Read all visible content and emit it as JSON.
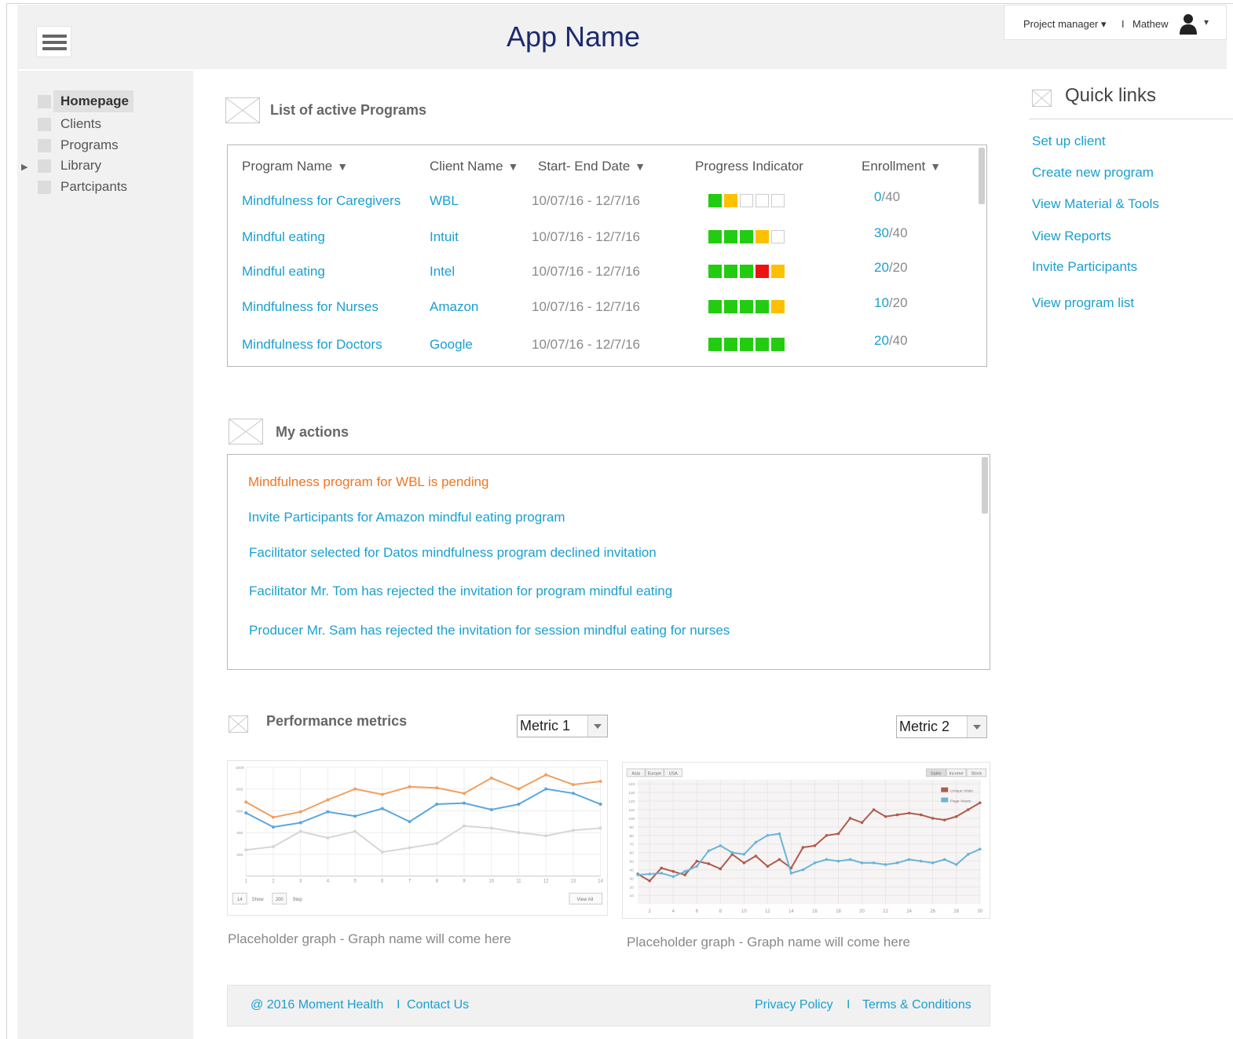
{
  "header": {
    "app_name": "App Name",
    "role": "Project manager ▾",
    "separator": "I",
    "user_name": "Mathew",
    "user_caret": "▾"
  },
  "sidebar": {
    "items": [
      {
        "label": "Homepage",
        "active": true
      },
      {
        "label": "Clients"
      },
      {
        "label": "Programs"
      },
      {
        "label": "Library",
        "expandable": true
      },
      {
        "label": "Partcipants"
      }
    ]
  },
  "programs": {
    "title": "List of active Programs",
    "columns": [
      "Program Name",
      "Client Name",
      "Start- End Date",
      "Progress Indicator",
      "Enrollment"
    ],
    "rows": [
      {
        "program": "Mindfulness for Caregivers",
        "client": "WBL",
        "dates": "10/07/16 - 12/7/16",
        "progress": [
          "green",
          "yellow",
          "empty",
          "empty",
          "empty"
        ],
        "enrolled": "0",
        "capacity": "/40"
      },
      {
        "program": "Mindful eating",
        "client": "Intuit",
        "dates": "10/07/16 - 12/7/16",
        "progress": [
          "green",
          "green",
          "green",
          "yellow",
          "empty"
        ],
        "enrolled": "30",
        "capacity": "/40"
      },
      {
        "program": "Mindful eating",
        "client": "Intel",
        "dates": "10/07/16 - 12/7/16",
        "progress": [
          "green",
          "green",
          "green",
          "red",
          "yellow"
        ],
        "enrolled": "20",
        "capacity": "/20"
      },
      {
        "program": "Mindfulness for Nurses",
        "client": "Amazon",
        "dates": "10/07/16 - 12/7/16",
        "progress": [
          "green",
          "green",
          "green",
          "green",
          "yellow"
        ],
        "enrolled": "10",
        "capacity": "/20"
      },
      {
        "program": "Mindfulness for Doctors",
        "client": "Google",
        "dates": "10/07/16 - 12/7/16",
        "progress": [
          "green",
          "green",
          "green",
          "green",
          "green"
        ],
        "enrolled": "20",
        "capacity": "/40"
      }
    ]
  },
  "actions": {
    "title": "My actions",
    "items": [
      {
        "text": "Mindfulness program for WBL is pending",
        "status": "pending"
      },
      {
        "text": "Invite Participants for Amazon mindful eating program"
      },
      {
        "text": "Facilitator selected for Datos mindfulness program declined invitation"
      },
      {
        "text": "Facilitator Mr. Tom  has rejected the invitation for program mindful eating"
      },
      {
        "text": "Producer Mr. Sam  has rejected the invitation for session mindful eating  for nurses"
      }
    ]
  },
  "metrics": {
    "title": "Performance metrics",
    "metric1": "Metric 1",
    "metric2": "Metric 2",
    "caption1": "Placeholder graph - Graph name will come here",
    "caption2": "Placeholder graph - Graph name will come here"
  },
  "quick_links": {
    "title": "Quick links",
    "links": [
      "Set up client",
      "Create new program",
      "View Material & Tools",
      "View Reports",
      "Invite Participants",
      "View program list"
    ]
  },
  "footer": {
    "copyright": "@ 2016 Moment Health",
    "sep": "I",
    "contact": "Contact Us",
    "privacy": "Privacy Policy",
    "sep2": "I",
    "terms": "Terms & Conditions"
  },
  "colors": {
    "link": "#1a9fd0",
    "pending": "#f07522",
    "progress_green": "#22cc11",
    "progress_yellow": "#ffc000",
    "progress_red": "#ee1111",
    "app_name": "#1c2a6e"
  },
  "chart_data": [
    {
      "type": "line",
      "x": [
        1,
        2,
        3,
        4,
        5,
        6,
        7,
        8,
        9,
        10,
        11,
        12,
        13,
        14
      ],
      "ylim": [
        0,
        1000
      ],
      "y_ticks": [
        "1000",
        "800",
        "600",
        "400",
        "200"
      ],
      "controls": [
        "14",
        "Show",
        "200",
        "Step",
        "View All"
      ],
      "series": [
        {
          "color": "#f0a060",
          "values": [
            680,
            540,
            590,
            700,
            800,
            750,
            820,
            810,
            760,
            900,
            800,
            930,
            840,
            870
          ]
        },
        {
          "color": "#5aa6dc",
          "values": [
            580,
            450,
            490,
            590,
            550,
            620,
            500,
            660,
            670,
            610,
            660,
            800,
            760,
            660
          ]
        },
        {
          "color": "#d6d6d6",
          "values": [
            240,
            270,
            410,
            350,
            410,
            220,
            260,
            300,
            460,
            440,
            400,
            370,
            420,
            440
          ]
        }
      ]
    },
    {
      "type": "line",
      "x": [
        1,
        2,
        3,
        4,
        5,
        6,
        7,
        8,
        9,
        10,
        11,
        12,
        13,
        14,
        15,
        16,
        17,
        18,
        19,
        20,
        21,
        22,
        23,
        24,
        25,
        26,
        27,
        28,
        29,
        30
      ],
      "x_ticks": [
        "2",
        "4",
        "6",
        "8",
        "10",
        "12",
        "14",
        "16",
        "18",
        "20",
        "22",
        "24",
        "26",
        "28",
        "30"
      ],
      "y_ticks": [
        "140",
        "130",
        "120",
        "110",
        "100",
        "90",
        "80",
        "70",
        "60",
        "50",
        "40",
        "30",
        "20",
        "10"
      ],
      "ylim": [
        0,
        145
      ],
      "tabs_left": [
        "Asia",
        "Europe",
        "USA"
      ],
      "tabs_right": [
        "Sales",
        "Income",
        "Stock"
      ],
      "series": [
        {
          "name": "Unique Visits",
          "color": "#b05a4a",
          "values": [
            35,
            27,
            42,
            38,
            34,
            50,
            47,
            41,
            58,
            48,
            56,
            44,
            52,
            42,
            66,
            68,
            80,
            82,
            100,
            95,
            110,
            102,
            104,
            106,
            104,
            100,
            98,
            102,
            110,
            118
          ]
        },
        {
          "name": "Page Views",
          "color": "#6ab4d8",
          "values": [
            34,
            35,
            36,
            32,
            38,
            44,
            62,
            68,
            60,
            58,
            72,
            80,
            82,
            36,
            40,
            48,
            52,
            50,
            52,
            48,
            48,
            46,
            48,
            52,
            50,
            48,
            52,
            46,
            58,
            64
          ]
        }
      ]
    }
  ]
}
